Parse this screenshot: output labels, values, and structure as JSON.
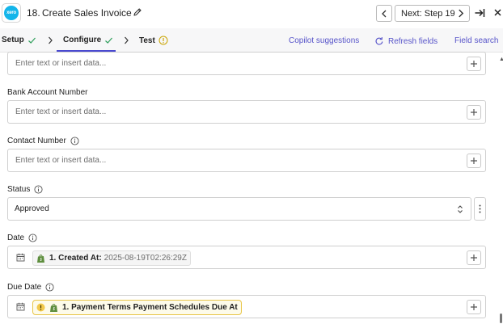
{
  "header": {
    "step_number": "18.",
    "title": "Create Sales Invoice",
    "next_label": "Next: Step 19",
    "app_icon_text": "xero"
  },
  "tabs": {
    "setup": "Setup",
    "configure": "Configure",
    "test": "Test",
    "copilot": "Copilot suggestions",
    "refresh": "Refresh fields",
    "field_search": "Field search"
  },
  "fields": {
    "top_placeholder": "Enter text or insert data...",
    "bank_account": {
      "label": "Bank Account Number",
      "placeholder": "Enter text or insert data..."
    },
    "contact_number": {
      "label": "Contact Number",
      "placeholder": "Enter text or insert data..."
    },
    "status": {
      "label": "Status",
      "value": "Approved"
    },
    "date": {
      "label": "Date",
      "pill_label": "1. Created At:",
      "pill_value": "2025-08-19T02:26:29Z"
    },
    "due_date": {
      "label": "Due Date",
      "pill_label": "1. Payment Terms Payment Schedules Due At"
    }
  },
  "colors": {
    "accent": "#5653c9",
    "check": "#2e9e5b",
    "warning": "#e8c547",
    "xero_blue": "#13b5ea",
    "shopify_green": "#5e8e3e"
  }
}
